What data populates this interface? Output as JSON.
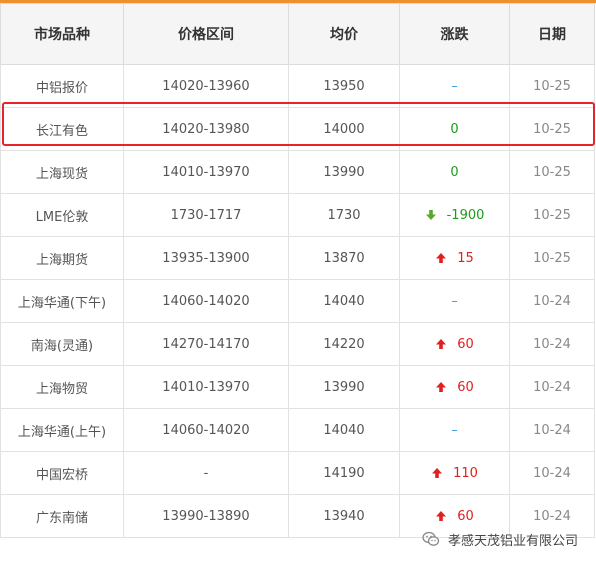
{
  "header": [
    "市场品种",
    "价格区间",
    "均价",
    "涨跌",
    "日期"
  ],
  "rows": [
    {
      "market": "中铝报价",
      "range": "14020-13960",
      "avg": "13950",
      "change": "–",
      "trend": "flat",
      "date": "10-25"
    },
    {
      "market": "长江有色",
      "range": "14020-13980",
      "avg": "14000",
      "change": "0",
      "trend": "zero",
      "date": "10-25"
    },
    {
      "market": "上海现货",
      "range": "14010-13970",
      "avg": "13990",
      "change": "0",
      "trend": "zero",
      "date": "10-25"
    },
    {
      "market": "LME伦敦",
      "range": "1730-1717",
      "avg": "1730",
      "change": "-1900",
      "trend": "down",
      "date": "10-25"
    },
    {
      "market": "上海期货",
      "range": "13935-13900",
      "avg": "13870",
      "change": "15",
      "trend": "up",
      "date": "10-25"
    },
    {
      "market": "上海华通(下午)",
      "range": "14060-14020",
      "avg": "14040",
      "change": "–",
      "trend": "flat",
      "date": "10-24"
    },
    {
      "market": "南海(灵通)",
      "range": "14270-14170",
      "avg": "14220",
      "change": "60",
      "trend": "up",
      "date": "10-24"
    },
    {
      "market": "上海物贸",
      "range": "14010-13970",
      "avg": "13990",
      "change": "60",
      "trend": "up",
      "date": "10-24"
    },
    {
      "market": "上海华通(上午)",
      "range": "14060-14020",
      "avg": "14040",
      "change": "–",
      "trend": "flat",
      "date": "10-24"
    },
    {
      "market": "中国宏桥",
      "range": "-",
      "avg": "14190",
      "change": "110",
      "trend": "up",
      "date": "10-24"
    },
    {
      "market": "广东南储",
      "range": "13990-13890",
      "avg": "13940",
      "change": "60",
      "trend": "up",
      "date": "10-24"
    }
  ],
  "watermark": {
    "text": "孝感天茂铝业有限公司",
    "icon": "wechat-icon"
  },
  "colors": {
    "accent": "#f08f2f",
    "up": "#e02020",
    "down": "#1d9b1d",
    "flat": "#3a9bd9",
    "highlight": "#e8232a"
  }
}
